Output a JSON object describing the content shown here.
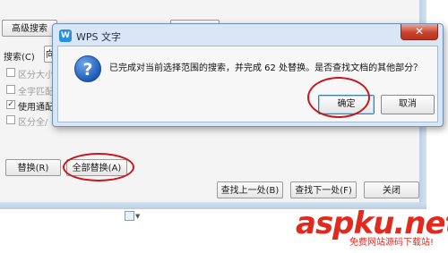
{
  "find_dialog": {
    "advanced_search_label": "高级搜索",
    "search_label": "搜索(C)",
    "direction_value": "向",
    "options": [
      {
        "label": "区分大小",
        "checked": false
      },
      {
        "label": "全字匹配",
        "checked": false
      },
      {
        "label": "使用通配",
        "checked": true
      },
      {
        "label": "区分全/",
        "checked": false
      }
    ],
    "replace_label": "替换(R)",
    "replace_all_label": "全部替换(A)",
    "find_prev_label": "查找上一处(B)",
    "find_next_label": "查找下一处(F)",
    "close_label": "关闭"
  },
  "message_dialog": {
    "icon_text": "W",
    "title": "WPS 文字",
    "close_glyph": "✕",
    "question_glyph": "?",
    "message": "已完成对当前选择范围的搜索，并完成 62 处替换。是否查找文档的其他部分？",
    "ok_label": "确定",
    "cancel_label": "取消"
  },
  "highlight_color": "#c8161d",
  "watermark": {
    "logo": "aspku.net",
    "subtitle": "免费网站源码下载站!"
  }
}
